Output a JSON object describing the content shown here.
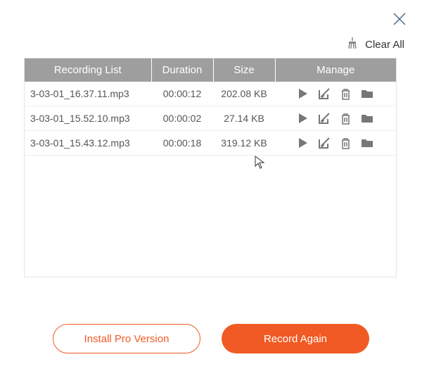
{
  "toolbar": {
    "clear_all_label": "Clear All"
  },
  "table": {
    "headers": {
      "name": "Recording List",
      "duration": "Duration",
      "size": "Size",
      "manage": "Manage"
    },
    "rows": [
      {
        "name": "3-03-01_16.37.11.mp3",
        "duration": "00:00:12",
        "size": "202.08 KB"
      },
      {
        "name": "3-03-01_15.52.10.mp3",
        "duration": "00:00:02",
        "size": "27.14 KB"
      },
      {
        "name": "3-03-01_15.43.12.mp3",
        "duration": "00:00:18",
        "size": "319.12 KB"
      }
    ]
  },
  "footer": {
    "install_pro_label": "Install Pro Version",
    "record_again_label": "Record Again"
  }
}
